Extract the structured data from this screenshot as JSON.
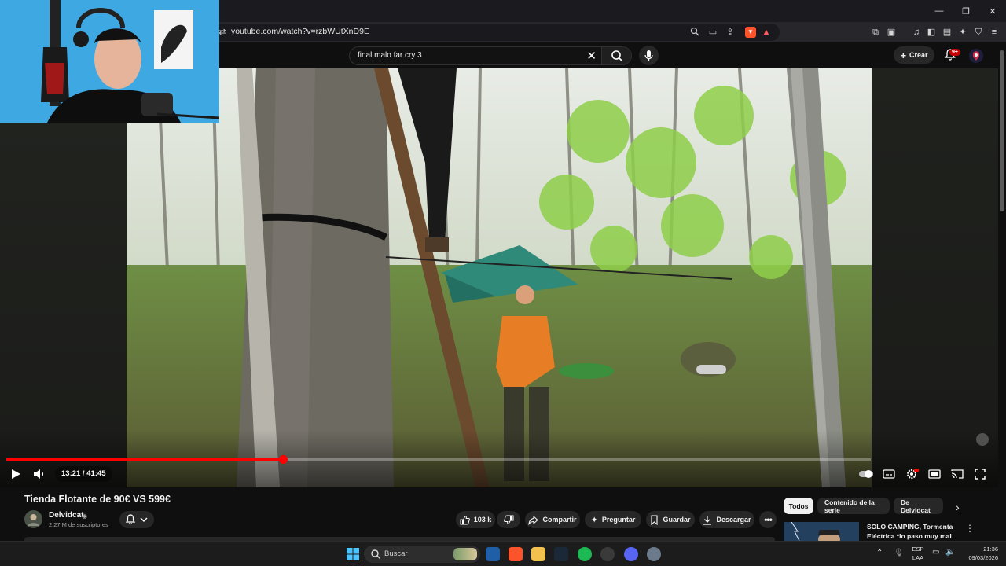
{
  "browser": {
    "url": "youtube.com/watch?v=rzbWUtXnD9E",
    "window_buttons": [
      "—",
      "❐",
      "✕"
    ]
  },
  "header": {
    "search_query": "final malo far cry 3",
    "create_label": "Crear",
    "notifications_badge": "9+"
  },
  "player": {
    "time": "13:21 / 41:45",
    "progress_fraction": 0.32
  },
  "video": {
    "title": "Tienda Flotante de 90€ VS 599€",
    "channel": "Delvidcat",
    "subscribers": "2.27 M de suscriptores",
    "likes": "103 k"
  },
  "actions": {
    "share": "Compartir",
    "ask": "Preguntar",
    "save": "Guardar",
    "download": "Descargar"
  },
  "chips": [
    {
      "label": "Todos",
      "active": true
    },
    {
      "label": "Contenido de la serie",
      "active": false
    },
    {
      "label": "De Delvidcat",
      "active": false
    }
  ],
  "recommendation": {
    "title": "SOLO CAMPING, Tormenta Eléctrica *lo paso muy mal 😵"
  },
  "taskbar": {
    "search_placeholder": "Buscar",
    "lang_1": "ESP",
    "lang_2": "LAA",
    "time": "21:36",
    "date": "09/03/2026"
  },
  "colors": {
    "progress": "#ff0000",
    "yt_background": "#0f0f0f",
    "button_bg": "#272727"
  }
}
